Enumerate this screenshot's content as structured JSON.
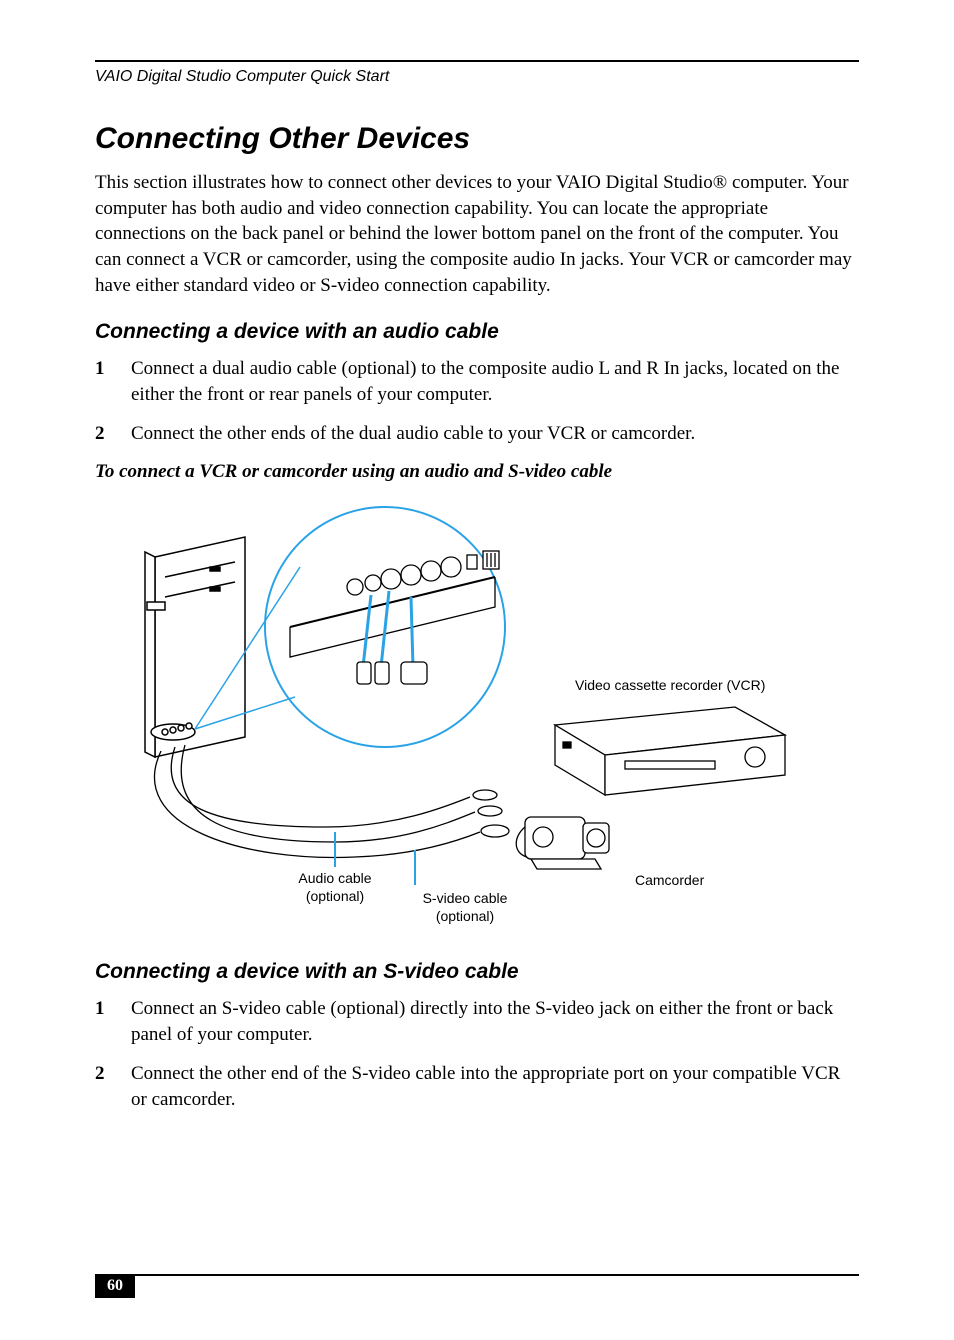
{
  "runningHead": "VAIO Digital Studio Computer Quick Start",
  "title": "Connecting Other Devices",
  "intro": "This section illustrates how to connect other devices to your VAIO Digital Studio® computer. Your computer has both audio and video connection capability. You can locate the appropriate connections on the back panel or behind the lower bottom panel on the front of the computer. You can connect a VCR or camcorder, using the composite audio In jacks. Your VCR or camcorder may have either standard video or S-video connection capability.",
  "sectionAudio": {
    "heading": "Connecting a device with an audio cable",
    "steps": [
      {
        "num": "1",
        "text": "Connect a dual audio cable (optional) to the composite audio L and R In jacks, located on the either the front or rear panels of your computer."
      },
      {
        "num": "2",
        "text": "Connect the other ends of the dual audio cable to your VCR or camcorder."
      }
    ]
  },
  "figure": {
    "title": "To connect a VCR or camcorder using an audio and S-video cable",
    "labels": {
      "vcr": "Video cassette recorder (VCR)",
      "camcorder": "Camcorder",
      "audioCable1": "Audio cable",
      "audioCable2": "(optional)",
      "svideoCable1": "S-video cable",
      "svideoCable2": "(optional)"
    }
  },
  "sectionSvideo": {
    "heading": "Connecting a device with an S-video cable",
    "steps": [
      {
        "num": "1",
        "text": "Connect an S-video cable (optional) directly into the S-video jack on either the front or back panel of your computer."
      },
      {
        "num": "2",
        "text": "Connect the other end of the S-video cable into the appropriate port on your compatible VCR or camcorder."
      }
    ]
  },
  "pageNumber": "60"
}
